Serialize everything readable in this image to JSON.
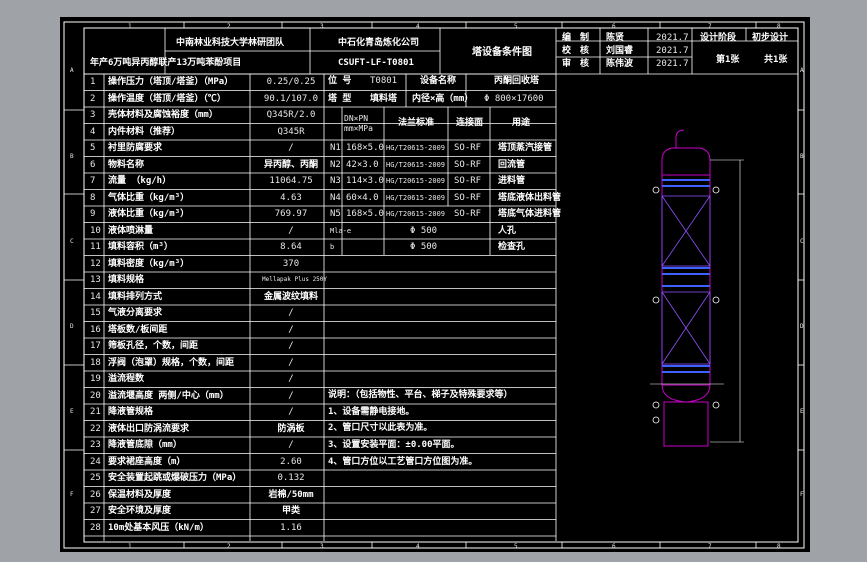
{
  "frame": {
    "col_labels": [
      "1",
      "2",
      "3",
      "4",
      "5",
      "6",
      "7",
      "8"
    ],
    "row_labels": [
      "A",
      "B",
      "C",
      "D",
      "E",
      "F"
    ]
  },
  "title_block": {
    "org": "中南林业科技大学林研团队",
    "project": "年产6万吨异丙醇联产13万吨苯酚项目",
    "company": "中石化青岛炼化公司",
    "drawing_no": "CSUFT-LF-T0801",
    "sheet_title": "塔设备条件图",
    "roles": [
      "编　制",
      "校　核",
      "审　核"
    ],
    "names": [
      "陈贤",
      "刘国睿",
      "陈伟波"
    ],
    "dates": [
      "2021.7",
      "2021.7",
      "2021.7"
    ],
    "stage_label": "设计阶段",
    "stage_value": "初步设计",
    "sheet_no": "第1张",
    "sheet_total": "共1张"
  },
  "left_table": [
    {
      "no": "1",
      "name": "操作压力（塔顶/塔釜）（MPa）",
      "value": "0.25/0.25"
    },
    {
      "no": "2",
      "name": "操作温度（塔顶/塔釜）（℃）",
      "value": "90.1/107.0"
    },
    {
      "no": "3",
      "name": "壳体材料及腐蚀裕度（mm）",
      "value": "Q345R/2.0"
    },
    {
      "no": "4",
      "name": "内件材料（推荐）",
      "value": "Q345R"
    },
    {
      "no": "5",
      "name": "衬里防腐要求",
      "value": "/"
    },
    {
      "no": "6",
      "name": "物料名称",
      "value": "异丙醇、丙酮"
    },
    {
      "no": "7",
      "name": "流量 （kg/h）",
      "value": "11064.75"
    },
    {
      "no": "8",
      "name": "气体比重（kg/m³）",
      "value": "4.63"
    },
    {
      "no": "9",
      "name": "液体比重（kg/m³）",
      "value": "769.97"
    },
    {
      "no": "10",
      "name": "液体喷淋量",
      "value": "/"
    },
    {
      "no": "11",
      "name": "填料容积（m³）",
      "value": "8.64"
    },
    {
      "no": "12",
      "name": "填料密度（kg/m³）",
      "value": "370"
    },
    {
      "no": "13",
      "name": "填料规格",
      "value": "Mellapak Plus 250Y"
    },
    {
      "no": "14",
      "name": "填料排列方式",
      "value": "金属波纹填料"
    },
    {
      "no": "15",
      "name": "气液分离要求",
      "value": "/"
    },
    {
      "no": "16",
      "name": "塔板数/板间距",
      "value": "/"
    },
    {
      "no": "17",
      "name": "筛板孔径，个数，间距",
      "value": "/"
    },
    {
      "no": "18",
      "name": "浮阀（泡罩）规格，个数，间距",
      "value": "/"
    },
    {
      "no": "19",
      "name": "溢流程数",
      "value": "/"
    },
    {
      "no": "20",
      "name": "溢流堰高度 两侧/中心（mm）",
      "value": "/"
    },
    {
      "no": "21",
      "name": "降液管规格",
      "value": "/"
    },
    {
      "no": "22",
      "name": "液体出口防涡流要求",
      "value": "防涡板"
    },
    {
      "no": "23",
      "name": "降液管底隙（mm）",
      "value": "/"
    },
    {
      "no": "24",
      "name": "要求裙座高度（m）",
      "value": "2.60"
    },
    {
      "no": "25",
      "name": "安全装置起跳或爆破压力（MPa）",
      "value": "0.132"
    },
    {
      "no": "26",
      "name": "保温材料及厚度",
      "value": "岩棉/50mm"
    },
    {
      "no": "27",
      "name": "安全环境及厚度",
      "value": "甲类"
    },
    {
      "no": "28",
      "name": "10m处基本风压（kN/m）",
      "value": "1.16"
    }
  ],
  "info": {
    "position_label": "位 号",
    "position_value": "T0801",
    "device_name_label": "设备名称",
    "device_name_value": "丙酮回收塔",
    "tower_type_label": "塔 型",
    "tower_type_value": "填料塔",
    "dimension_label": "内径×高（mm）",
    "dimension_value": "Φ 800×17600"
  },
  "nozzle_table": {
    "headers": [
      "",
      "DN×PN mm×MPa",
      "法兰标准",
      "连接面",
      "用途"
    ],
    "rows": [
      {
        "id": "N1",
        "dn": "168×5.0",
        "std": "HG/T20615-2009",
        "face": "SO-RF",
        "use": "塔顶蒸汽接管"
      },
      {
        "id": "N2",
        "dn": "42×3.0",
        "std": "HG/T20615-2009",
        "face": "SO-RF",
        "use": "回流管"
      },
      {
        "id": "N3",
        "dn": "114×3.0",
        "std": "HG/T20615-2009",
        "face": "SO-RF",
        "use": "进料管"
      },
      {
        "id": "N4",
        "dn": "60×4.0",
        "std": "HG/T20615-2009",
        "face": "SO-RF",
        "use": "塔底液体出料管"
      },
      {
        "id": "N5",
        "dn": "168×5.0",
        "std": "HG/T20615-2009",
        "face": "SO-RF",
        "use": "塔底气体进料管"
      },
      {
        "id": "Mla-e",
        "dn": "",
        "std": "Φ 500",
        "face": "",
        "use": "人孔"
      },
      {
        "id": "b",
        "dn": "",
        "std": "Φ 500",
        "face": "",
        "use": "检查孔"
      }
    ]
  },
  "notes": {
    "title": "说明：（包括物性、平台、梯子及特殊要求等）",
    "items": [
      "1、设备需静电接地。",
      "2、管口尺寸以此表为准。",
      "3、设置安装平面：±0.00平面。",
      "4、管口方位以工艺管口方位图为准。"
    ]
  },
  "colors": {
    "background": "#000000",
    "outer": "#9fa3a8",
    "line": "#ffffff",
    "text_yellow": "#f2f200",
    "tower": "#c800c8",
    "tower_hatch": "#8c50ff",
    "dimension": "#ffffff"
  }
}
